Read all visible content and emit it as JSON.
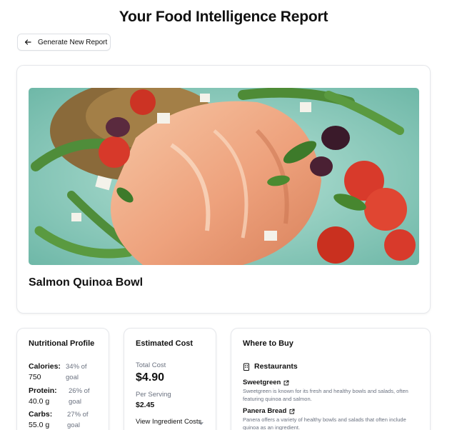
{
  "page": {
    "title": "Your Food Intelligence Report",
    "generate_button": "Generate New Report"
  },
  "dish": {
    "name": "Salmon Quinoa Bowl",
    "image_subject": "salmon quinoa bowl with tomatoes, olives, feta, green beans and basil"
  },
  "nutrition": {
    "title": "Nutritional Profile",
    "items": [
      {
        "label": "Calories:",
        "value": "750",
        "goal_line1": "34% of",
        "goal_line2": "goal"
      },
      {
        "label": "Protein:",
        "value": "40.0 g",
        "goal_line1": "26% of",
        "goal_line2": "goal"
      },
      {
        "label": "Carbs:",
        "value": "55.0 g",
        "goal_line1": "27% of",
        "goal_line2": "goal"
      }
    ]
  },
  "cost": {
    "title": "Estimated Cost",
    "total_label": "Total Cost",
    "total_value": "$4.90",
    "per_serving_label": "Per Serving",
    "per_serving_value": "$2.45",
    "toggle_label": "View Ingredient Costs"
  },
  "where_to_buy": {
    "title": "Where to Buy",
    "section_label": "Restaurants",
    "restaurants": [
      {
        "name": "Sweetgreen",
        "description": "Sweetgreen is known for its fresh and healthy bowls and salads, often featuring quinoa and salmon."
      },
      {
        "name": "Panera Bread",
        "description": "Panera offers a variety of healthy bowls and salads that often include quinoa as an ingredient."
      }
    ]
  },
  "colors": {
    "text_primary": "#111111",
    "text_muted": "#6b7280",
    "card_border": "#e5e7eb",
    "bowl_teal": "#8fd1c3",
    "salmon": "#f1a985"
  }
}
